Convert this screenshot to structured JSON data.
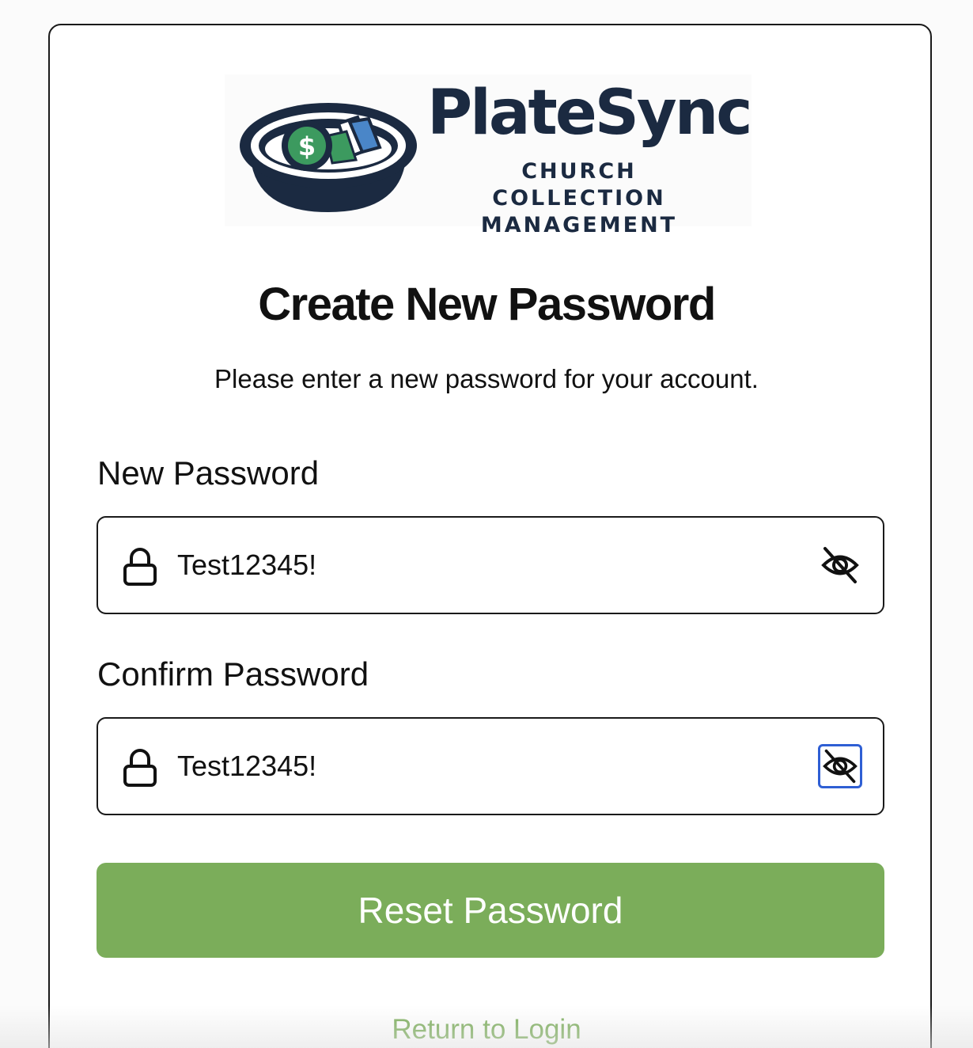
{
  "brand": {
    "name": "PlateSync",
    "tagline": "CHURCH COLLECTION MANAGEMENT",
    "logo_icons": [
      "collection-plate-icon",
      "dollar-coin-icon",
      "bills-icon"
    ],
    "colors": {
      "navy": "#1b2a41",
      "green": "#3c9a5f",
      "blue": "#4a86c8"
    }
  },
  "heading": "Create New Password",
  "subheading": "Please enter a new password for your account.",
  "new_password": {
    "label": "New Password",
    "value": "Test12345!",
    "icon": "lock-icon",
    "toggle_icon": "eye-off-icon"
  },
  "confirm_password": {
    "label": "Confirm Password",
    "value": "Test12345!",
    "icon": "lock-icon",
    "toggle_icon": "eye-off-icon"
  },
  "submit_label": "Reset Password",
  "return_link": "Return to Login",
  "colors": {
    "accent": "#7bad5a",
    "focus": "#2f5fd4",
    "text": "#111111"
  }
}
